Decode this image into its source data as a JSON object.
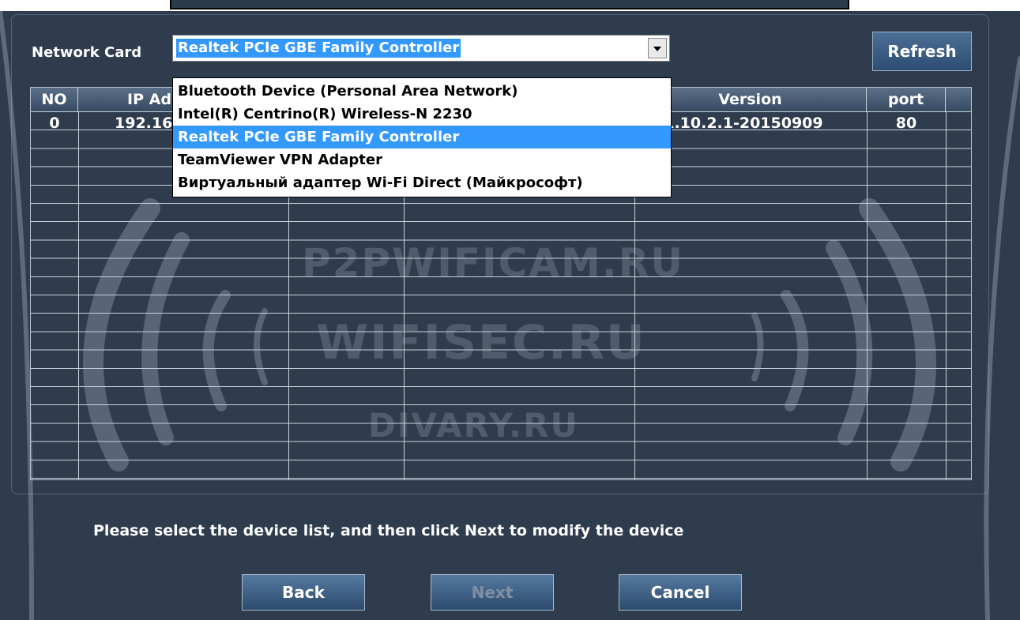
{
  "network_card": {
    "label": "Network Card",
    "selected": "Realtek PCIe GBE Family Controller",
    "options": [
      "Bluetooth Device (Personal Area Network)",
      "Intel(R) Centrino(R) Wireless-N 2230",
      "Realtek PCIe GBE Family Controller",
      "TeamViewer VPN Adapter",
      "Виртуальный адаптер Wi-Fi Direct (Майкрософт)"
    ],
    "highlighted_index": 2
  },
  "refresh_label": "Refresh",
  "table": {
    "headers": {
      "no": "NO",
      "ip": "IP Ad",
      "version": "Version",
      "port": "port"
    },
    "rows": [
      {
        "no": "0",
        "ip": "192.16",
        "version": ".1.10.2.1-20150909",
        "port": "80"
      }
    ]
  },
  "watermarks": [
    "P2PWIFICAM.RU",
    "WIFISEC.RU",
    "DIVARY.RU"
  ],
  "message": "Please select the device list, and then click Next to modify the device",
  "buttons": {
    "back": "Back",
    "next": "Next",
    "cancel": "Cancel"
  },
  "colors": {
    "window_bg": "#2e3c4d",
    "selection": "#3399ff",
    "button": "#3d6188"
  }
}
